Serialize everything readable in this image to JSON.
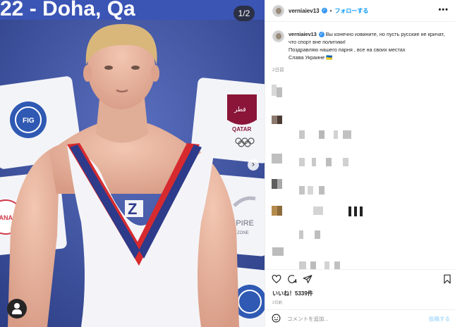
{
  "media": {
    "banner_text": "22 - Doha, Qa",
    "counter": "1/2",
    "sponsor_qatar_arabic": "قطر",
    "sponsor_qatar": "QATAR",
    "sponsor_fig": "FIG",
    "sponsor_aspire": "SPIRE",
    "sponsor_aspire_sub": "ZONE",
    "sponsor_left": "DANA",
    "shirt_letter": "Z"
  },
  "header": {
    "username": "verniaiev13",
    "separator": "•",
    "follow_label": "フォローする",
    "more_label": "•••"
  },
  "caption": {
    "username": "verniaiev13",
    "line1": " Вы конечно извините, но пусть русские не кричат, что спорт вне политики!",
    "line2": "Поздравляю нашего парня , все на своих местах",
    "line3": "Слава Украине 🇺🇦",
    "time": "2日前"
  },
  "actions": {
    "likes": "いいね！5339件",
    "time": "2日前"
  },
  "comment_box": {
    "placeholder": "コメントを追加...",
    "post_label": "投稿する"
  },
  "colors": {
    "accent": "#0095f6",
    "verified": "#3897f0",
    "post_disabled": "#b2dffc",
    "backdrop_blue": "#3a4f9a"
  }
}
